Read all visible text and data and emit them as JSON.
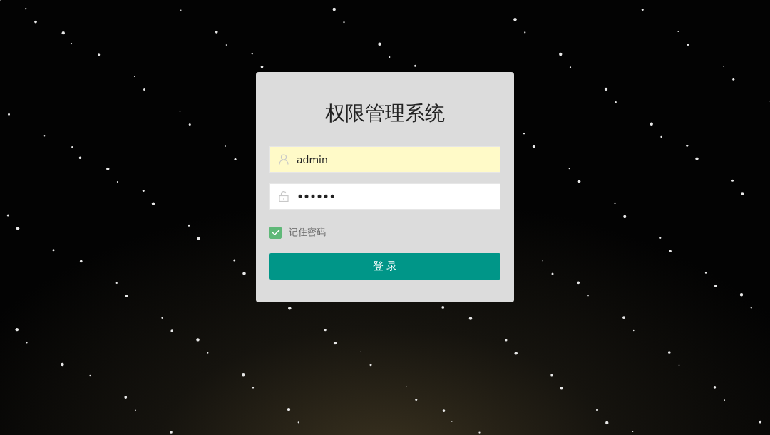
{
  "login_form": {
    "title": "权限管理系统",
    "username": {
      "value": "admin",
      "autofilled": true
    },
    "password": {
      "value": "••••••",
      "autofilled": false
    },
    "remember": {
      "label": "记住密码",
      "checked": true
    },
    "submit": {
      "label": "登 录"
    }
  }
}
